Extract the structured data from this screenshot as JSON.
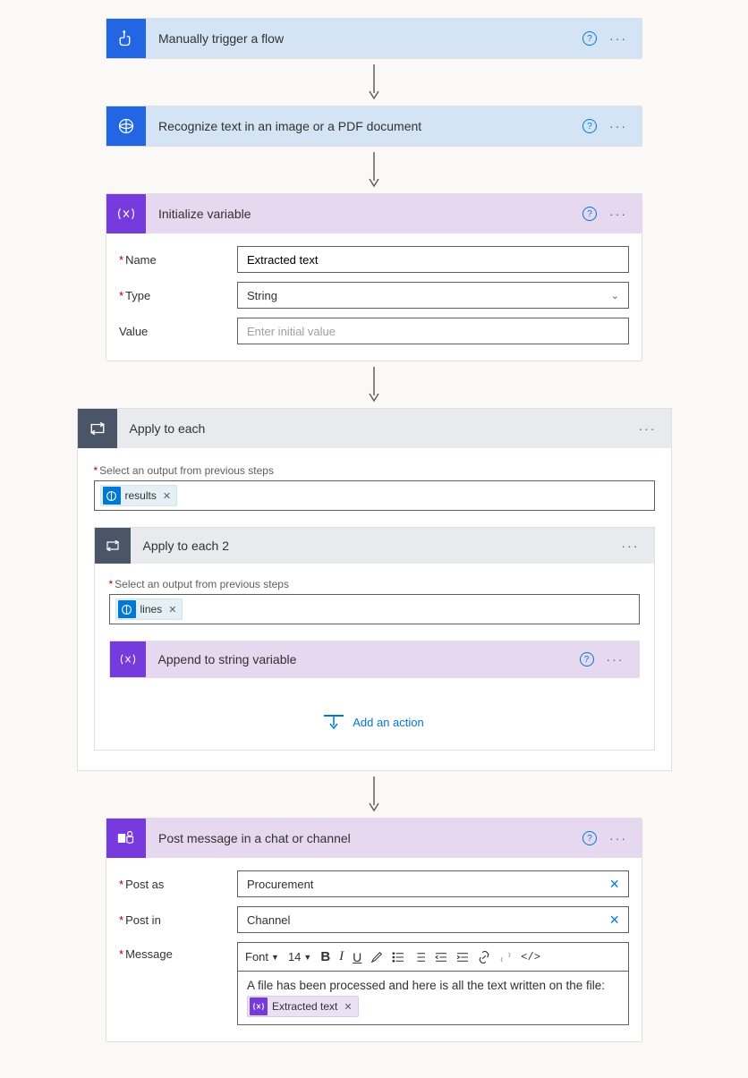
{
  "steps": {
    "trigger": {
      "title": "Manually trigger a flow"
    },
    "recognize": {
      "title": "Recognize text in an image or a PDF document"
    },
    "initVar": {
      "title": "Initialize variable",
      "fields": {
        "name_label": "Name",
        "name_value": "Extracted text",
        "type_label": "Type",
        "type_value": "String",
        "value_label": "Value",
        "value_placeholder": "Enter initial value"
      }
    },
    "applyEach": {
      "title": "Apply to each",
      "select_label": "Select an output from previous steps",
      "token": "results"
    },
    "applyEach2": {
      "title": "Apply to each 2",
      "select_label": "Select an output from previous steps",
      "token": "lines"
    },
    "appendString": {
      "title": "Append to string variable"
    },
    "addAction": "Add an action",
    "postMessage": {
      "title": "Post message in a chat or channel",
      "postAs_label": "Post as",
      "postAs_value": "Procurement",
      "postIn_label": "Post in",
      "postIn_value": "Channel",
      "message_label": "Message",
      "toolbar": {
        "font": "Font",
        "size": "14"
      },
      "message_text": "A file has been processed and here is all the text written on the file:",
      "message_token": "Extracted text"
    }
  }
}
